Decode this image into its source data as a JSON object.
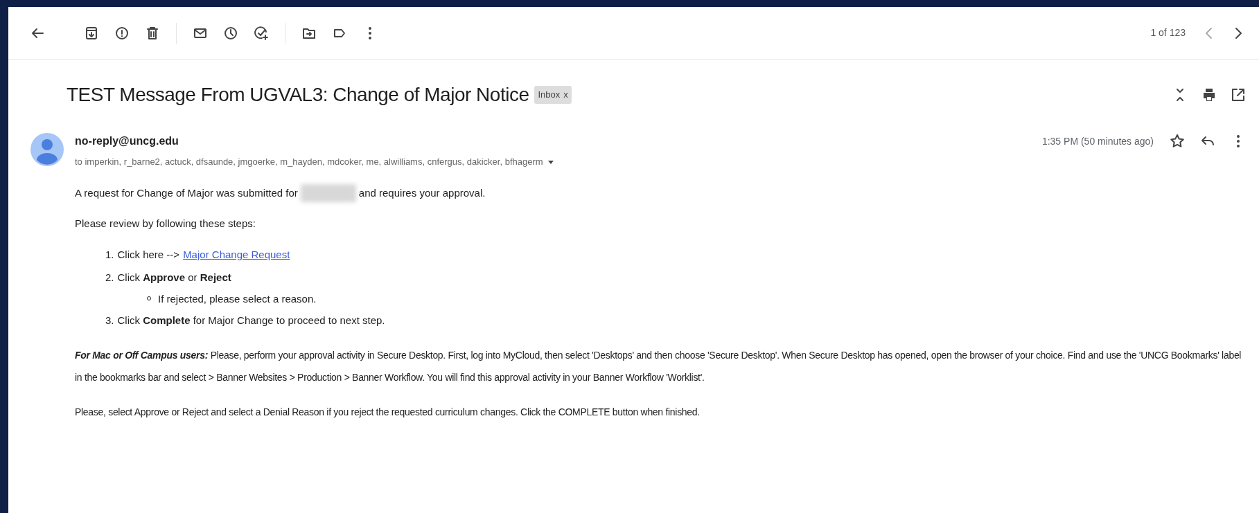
{
  "toolbar": {
    "pagination": "1 of 123"
  },
  "message": {
    "subject": "TEST Message From UGVAL3: Change of Major Notice",
    "label": {
      "text": "Inbox",
      "close": "x"
    },
    "sender": "no-reply@uncg.edu",
    "recipients": "to imperkin, r_barne2, actuck, dfsaunde, jmgoerke, m_hayden, mdcoker, me, alwilliams, cnfergus, dakicker, bfhagerm",
    "time": "1:35 PM (50 minutes ago)",
    "starred": false
  },
  "body": {
    "intro_before": "A request for Change of Major was submitted for",
    "intro_after": "and requires your approval.",
    "steps_intro": "Please review by following these steps:",
    "steps": [
      {
        "number": "1.",
        "text": "Click here -->",
        "link": "Major Change Request"
      },
      {
        "number": "2.",
        "text": "Click **Approve** or **Reject**",
        "children": [
          {
            "text": "If rejected, please select a reason."
          }
        ]
      },
      {
        "number": "3.",
        "text": "Click **Complete** for Major Change to proceed to next step."
      }
    ],
    "paragraphs": [
      {
        "lead": "For Mac or Off Campus users:",
        "text": "Please, perform your approval activity in Secure Desktop. First, log into MyCloud, then select 'Desktops' and then choose 'Secure Desktop'. When Secure Desktop has opened, open the browser of your choice. Find and use the 'UNCG Bookmarks' label in the bookmarks bar and select > Banner Websites > Production > Banner Workflow. You will find this approval activity in your Banner Workflow 'Worklist'."
      },
      {
        "text": "Please, select Approve or Reject and select a Denial Reason if you reject the requested curriculum changes. Click the COMPLETE button when finished."
      }
    ]
  }
}
